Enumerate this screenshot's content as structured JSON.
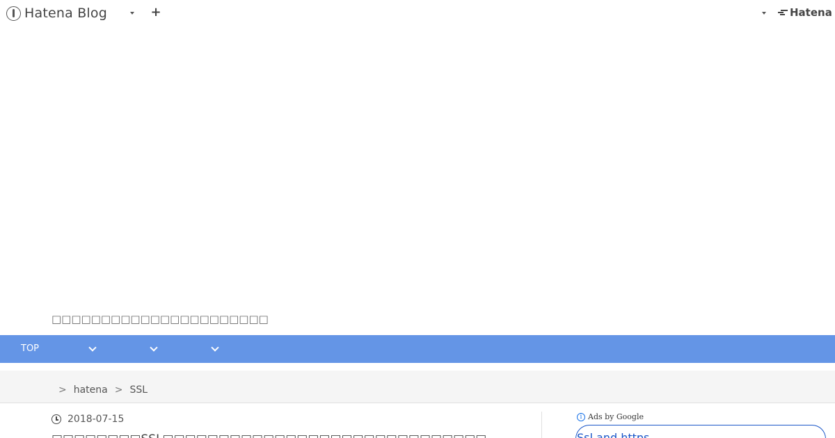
{
  "header": {
    "brand": "Hatena Blog",
    "plus": "+",
    "hatena": "Hatena"
  },
  "blog": {
    "description": "□□□□□□□□□□□□□□□□□□□□□□"
  },
  "category_nav": {
    "top_label": "TOP",
    "color": "#6495e6"
  },
  "breadcrumb": {
    "separator": ">",
    "items": [
      "hatena",
      "SSL"
    ]
  },
  "article": {
    "date": "2018-07-15",
    "title": "□□□□□□□□SSL□□□□□□□□□□□□□□□□□□□□□□□□□□□□□"
  },
  "sidebar": {
    "ads_label": "Ads by Google",
    "info": "i",
    "ad_link": "Ssl and https"
  }
}
